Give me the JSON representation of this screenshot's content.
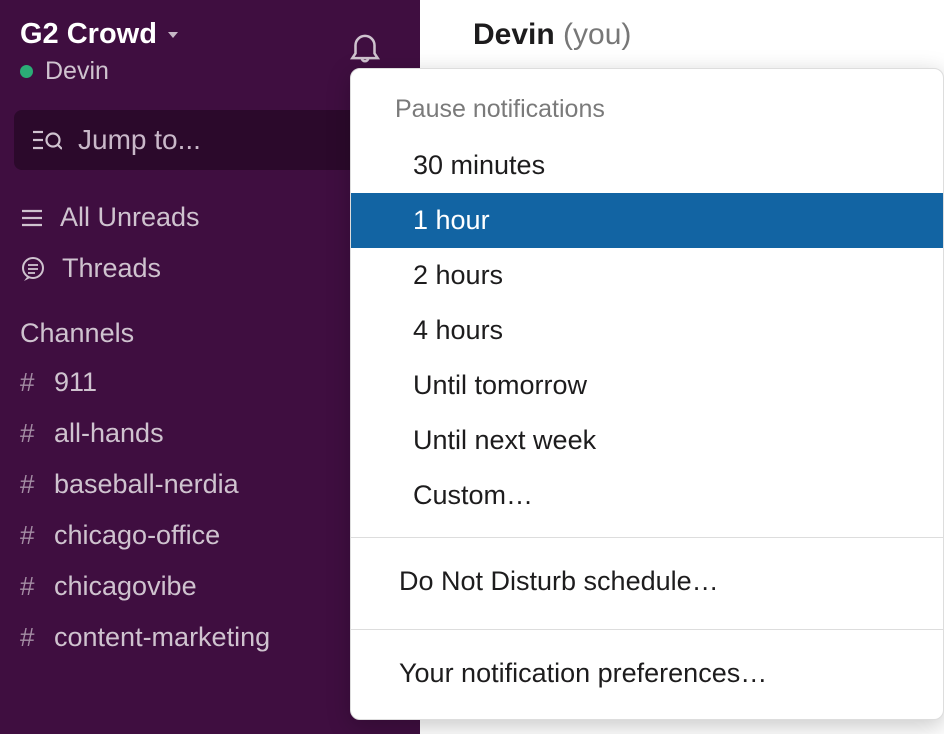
{
  "workspace": {
    "name": "G2 Crowd",
    "user": "Devin"
  },
  "jump_to": "Jump to...",
  "nav": {
    "all_unreads": "All Unreads",
    "threads": "Threads"
  },
  "channels_header": "Channels",
  "channels": [
    "911",
    "all-hands",
    "baseball-nerdia",
    "chicago-office",
    "chicagovibe",
    "content-marketing"
  ],
  "dm": {
    "name": "Devin",
    "you": "(you)"
  },
  "dd": {
    "heading": "Pause notifications",
    "items": [
      "30 minutes",
      "1 hour",
      "2 hours",
      "4 hours",
      "Until tomorrow",
      "Until next week",
      "Custom…"
    ],
    "selected_index": 1,
    "dnd": "Do Not Disturb schedule…",
    "prefs": "Your notification preferences…"
  }
}
